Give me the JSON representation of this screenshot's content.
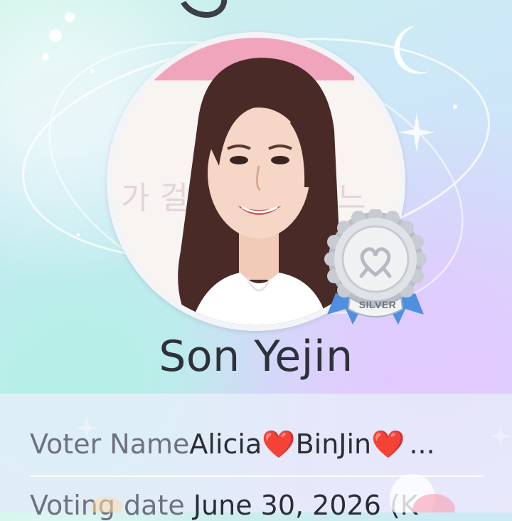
{
  "profile": {
    "name": "Son Yejin",
    "badge": "SILVER"
  },
  "details": {
    "voter_label": "Voter Name",
    "voter_value_part1": "Alicia",
    "heart1": "❤️",
    "voter_value_part2": "BinJin",
    "heart2": "❤️",
    "voter_ellipsis": "...",
    "date_label": "Voting date",
    "date_value": "June 30, 2026 (K"
  },
  "colors": {
    "badge_silver": "#c9ccd1",
    "ribbon_blue": "#4e8fe0",
    "text_dark": "#2d3139",
    "text_label": "#6e7280"
  },
  "icons": {
    "moon": "crescent-moon-icon",
    "star": "sparkle-icon",
    "badge_mark": "heart-knot-icon"
  }
}
